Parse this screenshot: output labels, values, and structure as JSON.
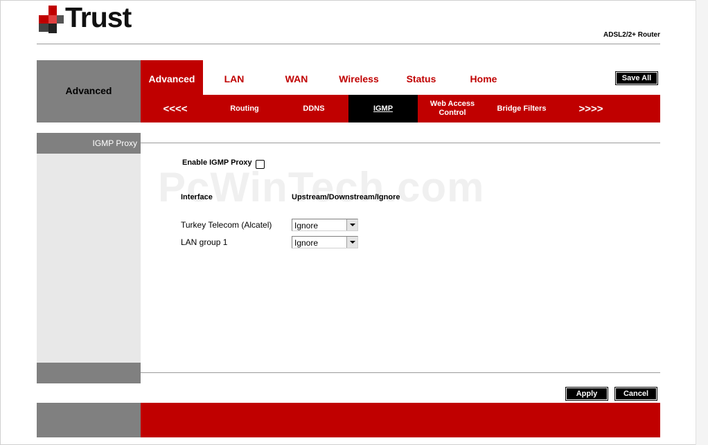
{
  "brand": {
    "name": "Trust",
    "model": "ADSL2/2+ Router",
    "colors": {
      "accent": "#c00000",
      "gray": "#808080",
      "dark": "#000000"
    }
  },
  "nav": {
    "section_title": "Advanced",
    "main_tabs": [
      {
        "label": "Advanced",
        "active": true
      },
      {
        "label": "LAN"
      },
      {
        "label": "WAN"
      },
      {
        "label": "Wireless"
      },
      {
        "label": "Status"
      },
      {
        "label": "Home"
      }
    ],
    "save_all_label": "Save All",
    "sub_tabs": [
      {
        "label": "<<<<"
      },
      {
        "label": "Routing"
      },
      {
        "label": "DDNS"
      },
      {
        "label": "IGMP",
        "active": true
      },
      {
        "label": "Web Access Control"
      },
      {
        "label": "Bridge Filters"
      },
      {
        "label": ">>>>"
      }
    ]
  },
  "sidebar": {
    "items": [
      {
        "label": "IGMP Proxy"
      }
    ]
  },
  "watermark": "PcWinTech.com",
  "igmp": {
    "enable_label": "Enable IGMP Proxy",
    "enabled": false,
    "columns": {
      "interface": "Interface",
      "mode": "Upstream/Downstream/Ignore"
    },
    "rows": [
      {
        "interface": "Turkey Telecom (Alcatel)",
        "mode": "Ignore"
      },
      {
        "interface": "LAN group 1",
        "mode": "Ignore"
      }
    ]
  },
  "buttons": {
    "apply": "Apply",
    "cancel": "Cancel"
  }
}
